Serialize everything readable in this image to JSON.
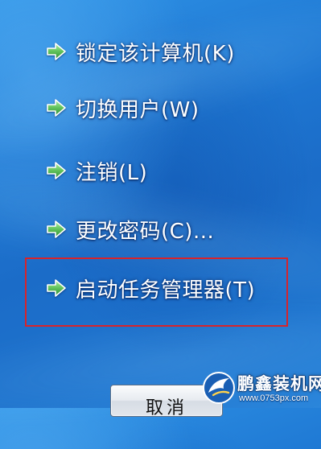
{
  "menu": {
    "items": [
      {
        "label": "锁定该计算机(K)",
        "icon": "arrow-right-icon"
      },
      {
        "label": "切换用户(W)",
        "icon": "arrow-right-icon"
      },
      {
        "label": "注销(L)",
        "icon": "arrow-right-icon"
      },
      {
        "label": "更改密码(C)...",
        "icon": "arrow-right-icon"
      },
      {
        "label": "启动任务管理器(T)",
        "icon": "arrow-right-icon",
        "highlighted": true
      }
    ]
  },
  "cancel_button": {
    "label": "取消"
  },
  "watermark": {
    "title": "鹏鑫装机网",
    "url": "www.0753px.com"
  },
  "colors": {
    "background": "#1f79d4",
    "highlight_border": "#d7242b",
    "icon_green": "#5cb85c",
    "text": "#ffffff"
  }
}
